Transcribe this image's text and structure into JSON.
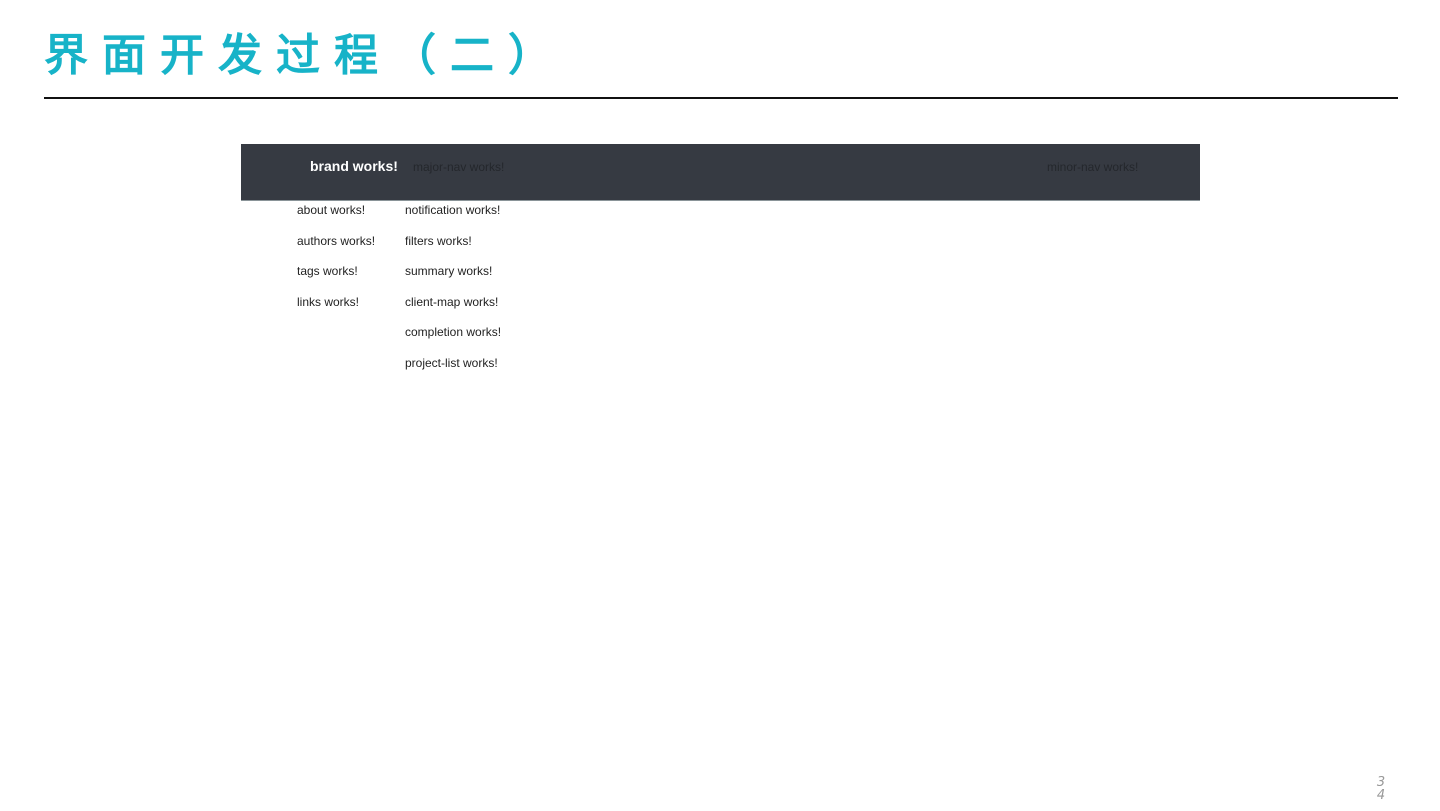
{
  "slide": {
    "title": "界面开发过程（二）",
    "page_number": [
      "3",
      "4"
    ]
  },
  "screenshot": {
    "navbar": {
      "brand": "brand works!",
      "major_nav": "major-nav works!",
      "minor_nav": "minor-nav works!"
    },
    "left_column": [
      "about works!",
      "authors works!",
      "tags works!",
      "links works!"
    ],
    "right_column": [
      "notification works!",
      "filters works!",
      "summary works!",
      "client-map works!",
      "completion works!",
      "project-list works!"
    ]
  }
}
